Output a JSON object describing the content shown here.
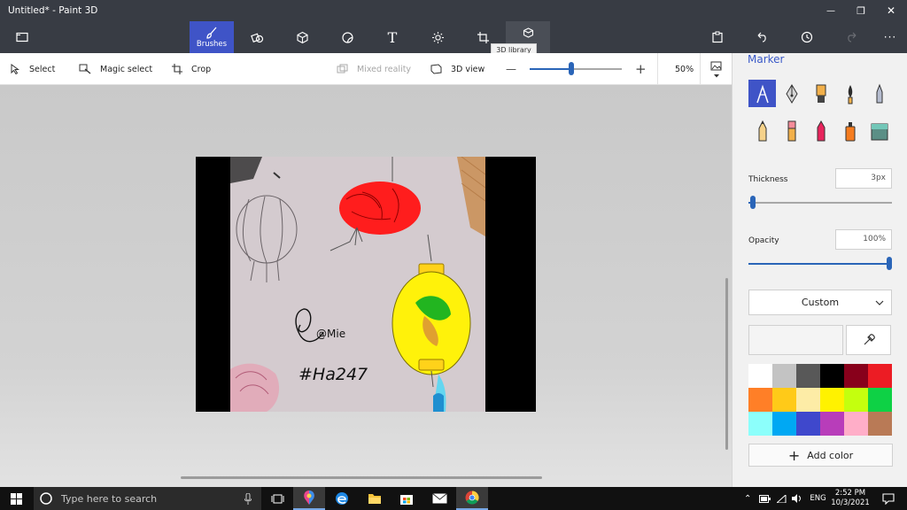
{
  "window": {
    "title": "Untitled* - Paint 3D",
    "minimize_icon": "—",
    "restore_icon": "❐",
    "close_icon": "✕"
  },
  "toolbar": {
    "brushes_label": "Brushes",
    "text_glyph": "T",
    "tooltip": "3D library",
    "more_label": "···"
  },
  "subtoolbar": {
    "select": "Select",
    "magic_select": "Magic select",
    "crop": "Crop",
    "mixed_reality": "Mixed reality",
    "view3d": "3D view",
    "zoom": "50%",
    "zoom_minus": "—",
    "zoom_plus": "+",
    "zoom_level": 0.45
  },
  "canvas": {
    "signature": "@Mie",
    "hashtag": "#Ha247"
  },
  "panel": {
    "title": "Marker",
    "thickness_label": "Thickness",
    "thickness_value": "3px",
    "thickness_level": 0.03,
    "opacity_label": "Opacity",
    "opacity_value": "100%",
    "opacity_level": 1.0,
    "color_mode": "Custom",
    "add_color": "Add color",
    "brushes": [
      "marker-icon",
      "calligraphy-pen-icon",
      "oil-brush-icon",
      "watercolor-icon",
      "pixel-pen-icon",
      "pencil-icon",
      "eraser-icon",
      "crayon-icon",
      "spray-can-icon",
      "fill-bucket-icon"
    ],
    "palette": [
      "#ffffff",
      "#c3c3c3",
      "#585858",
      "#000000",
      "#88001b",
      "#ec1c24",
      "#ff7f27",
      "#ffca18",
      "#fdeca6",
      "#fff200",
      "#c4ff0e",
      "#0ed145",
      "#8cfffb",
      "#00a8f3",
      "#3f48cc",
      "#b83dba",
      "#ffaec8",
      "#b97a56"
    ],
    "current_color": "#f4f4f4"
  },
  "taskbar": {
    "search_placeholder": "Type here to search",
    "lang": "ENG",
    "time": "2:52 PM",
    "date": "10/3/2021"
  },
  "colors": {
    "chrome": "#383c44",
    "accent": "#3f54c7",
    "panel": "#f1f1f1"
  }
}
